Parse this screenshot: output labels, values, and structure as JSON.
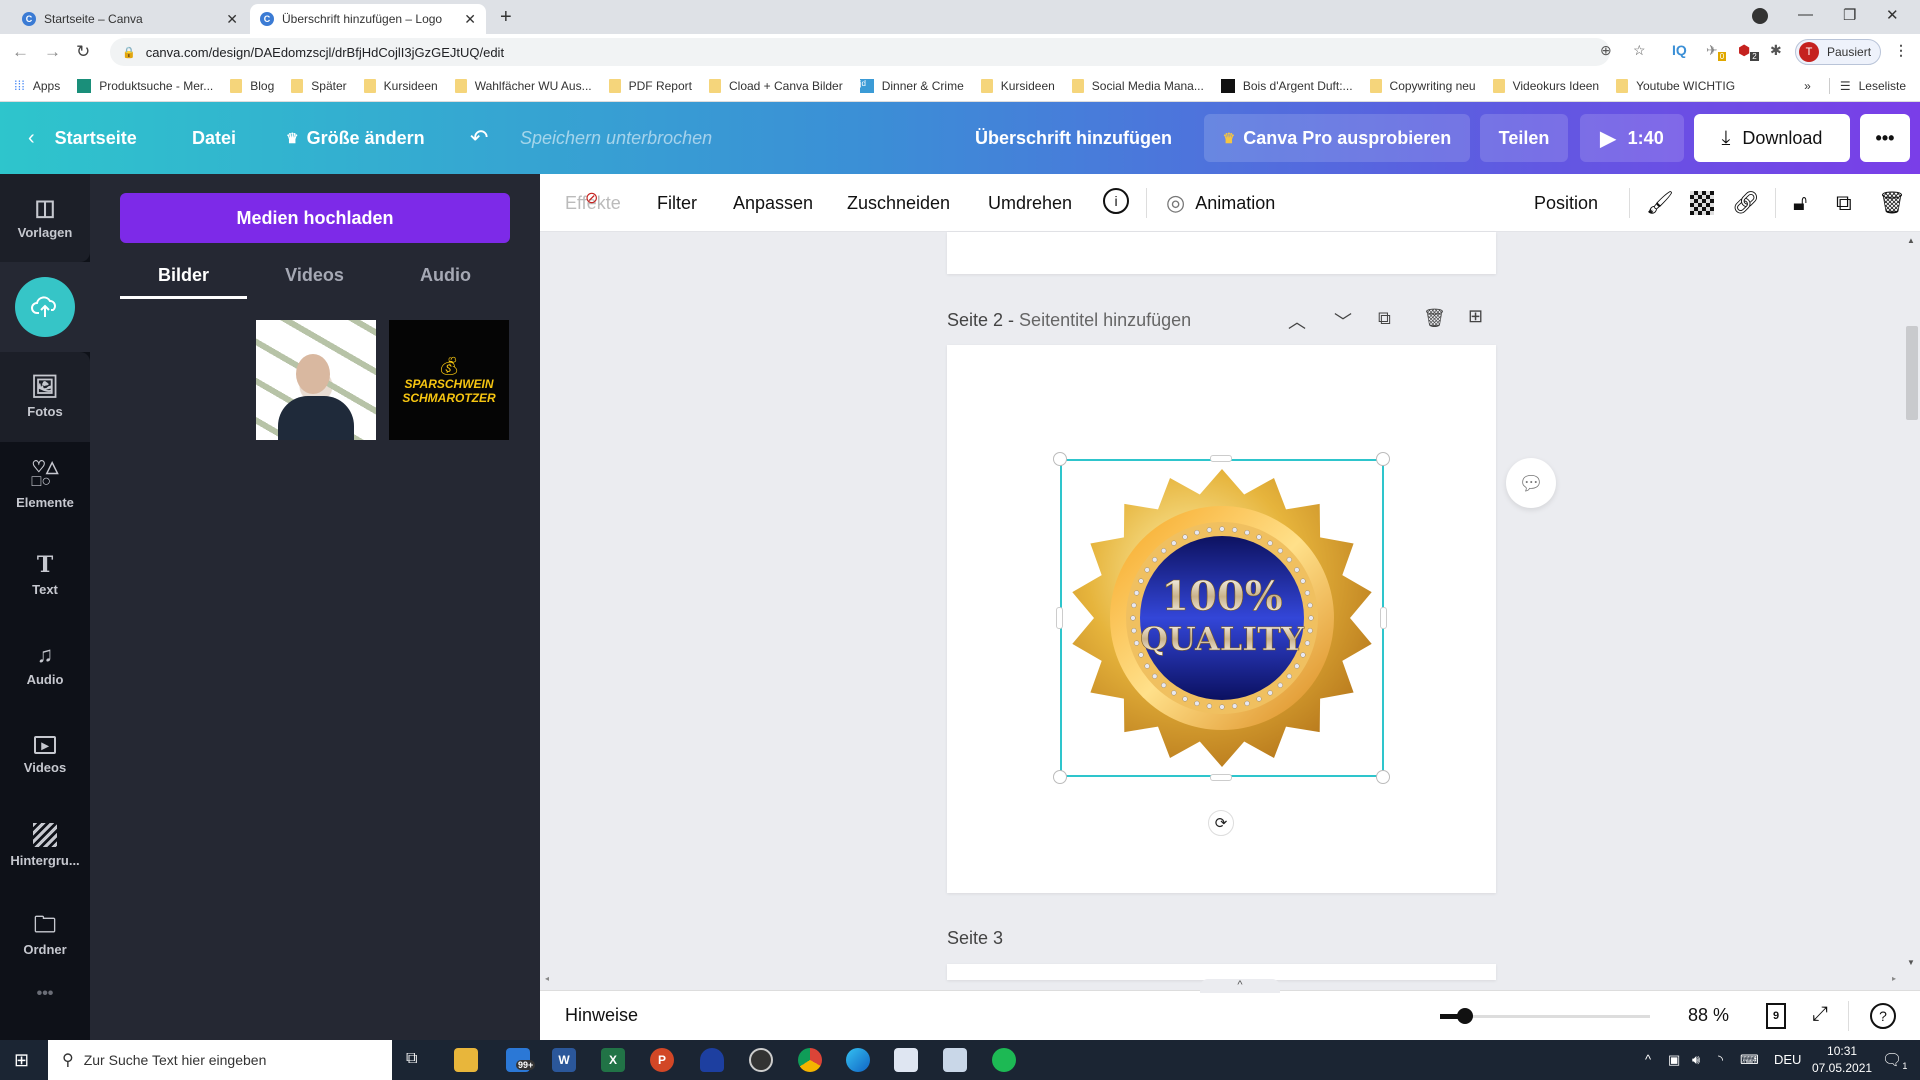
{
  "browser": {
    "tabs": [
      {
        "title": "Startseite – Canva",
        "active": false
      },
      {
        "title": "Überschrift hinzufügen – Logo",
        "active": true
      }
    ],
    "url": "canva.com/design/DAEdomzscjl/drBfjHdCojlI3jGzGEJtUQ/edit",
    "profile_initial": "T",
    "profile_label": "Pausiert",
    "ext_badges": {
      "notes": "0",
      "abp": "2"
    },
    "bookmarks": [
      {
        "label": "Apps",
        "icon": "apps-grid-icon"
      },
      {
        "label": "Produktsuche - Mer...",
        "icon": "site-icon"
      },
      {
        "label": "Blog",
        "icon": "folder-icon"
      },
      {
        "label": "Später",
        "icon": "folder-icon"
      },
      {
        "label": "Kursideen",
        "icon": "folder-icon"
      },
      {
        "label": "Wahlfächer WU Aus...",
        "icon": "folder-icon"
      },
      {
        "label": "PDF Report",
        "icon": "folder-icon"
      },
      {
        "label": "Cload + Canva Bilder",
        "icon": "folder-icon"
      },
      {
        "label": "Dinner & Crime",
        "icon": "site-icon"
      },
      {
        "label": "Kursideen",
        "icon": "folder-icon"
      },
      {
        "label": "Social Media Mana...",
        "icon": "folder-icon"
      },
      {
        "label": "Bois d'Argent Duft:...",
        "icon": "site-icon"
      },
      {
        "label": "Copywriting neu",
        "icon": "folder-icon"
      },
      {
        "label": "Videokurs Ideen",
        "icon": "folder-icon"
      },
      {
        "label": "Youtube WICHTIG",
        "icon": "folder-icon"
      }
    ],
    "bookmarks_more": "»",
    "reading_list": "Leseliste"
  },
  "header": {
    "home": "Startseite",
    "file": "Datei",
    "resize": "Größe ändern",
    "save_status": "Speichern unterbrochen",
    "design_title": "Überschrift hinzufügen",
    "pro": "Canva Pro ausprobieren",
    "share": "Teilen",
    "present_duration": "1:40",
    "download": "Download",
    "more": "•••"
  },
  "rail": [
    {
      "label": "Vorlagen",
      "icon": "templates-icon"
    },
    {
      "label": "Uploads",
      "icon": "upload-cloud-icon"
    },
    {
      "label": "Fotos",
      "icon": "photo-icon"
    },
    {
      "label": "Elemente",
      "icon": "elements-icon"
    },
    {
      "label": "Text",
      "icon": "text-icon"
    },
    {
      "label": "Audio",
      "icon": "music-icon"
    },
    {
      "label": "Videos",
      "icon": "video-icon"
    },
    {
      "label": "Hintergru...",
      "icon": "background-icon"
    },
    {
      "label": "Ordner",
      "icon": "folder-icon"
    }
  ],
  "panel": {
    "upload_button": "Medien hochladen",
    "tabs": [
      "Bilder",
      "Videos",
      "Audio"
    ],
    "active_tab": "Bilder",
    "thumb2_text": [
      "SPARSCHWEIN",
      "SCHMAROTZER"
    ]
  },
  "toolbar": {
    "effects": "Effekte",
    "filter": "Filter",
    "adjust": "Anpassen",
    "crop": "Zuschneiden",
    "flip": "Umdrehen",
    "animation": "Animation",
    "position": "Position"
  },
  "canvas": {
    "page2_label": "Seite 2",
    "page2_subtitle": "Seitentitel hinzufügen",
    "page3_label": "Seite 3",
    "badge_line1": "100%",
    "badge_line2": "QUALITY"
  },
  "bottombar": {
    "notes": "Hinweise",
    "zoom_percent": "88 %",
    "zoom_fraction": 0.12,
    "page_count": "9"
  },
  "taskbar": {
    "search_placeholder": "Zur Suche Text hier eingeben",
    "mail_badge": "99+",
    "language": "DEU",
    "time": "10:31",
    "date": "07.05.2021",
    "notif_count": "1"
  }
}
